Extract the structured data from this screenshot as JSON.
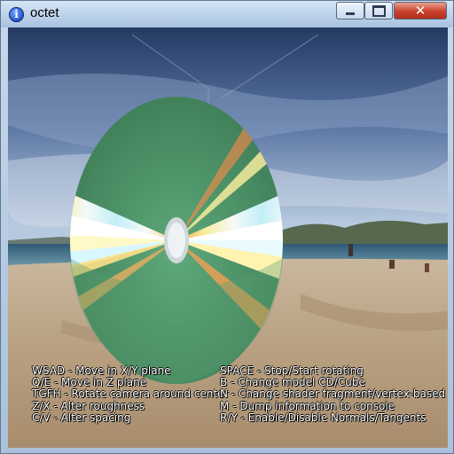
{
  "window": {
    "title": "octet",
    "app_icon": "info-icon",
    "buttons": [
      "minimize-icon",
      "maximize-icon",
      "close-icon"
    ],
    "close_color": "#c8412b"
  },
  "help": {
    "left": [
      "WSAD - Move in X/Y plane",
      "Q/E - Move in Z plane",
      "TGFH - Rotate camera around center",
      "Z/X - Alter roughness",
      "C/V - Alter spacing"
    ],
    "right": [
      "SPACE - Stop/Start rotating",
      "B - Change model CD/Cube",
      "N - Change shader fragment/vertex-based",
      "M - Dump information to console",
      "R/Y - Enable/Disable Normals/Tangents"
    ]
  },
  "scene": {
    "model": "CD",
    "disc_color": "#4c8d64",
    "background": "beach skybox"
  }
}
